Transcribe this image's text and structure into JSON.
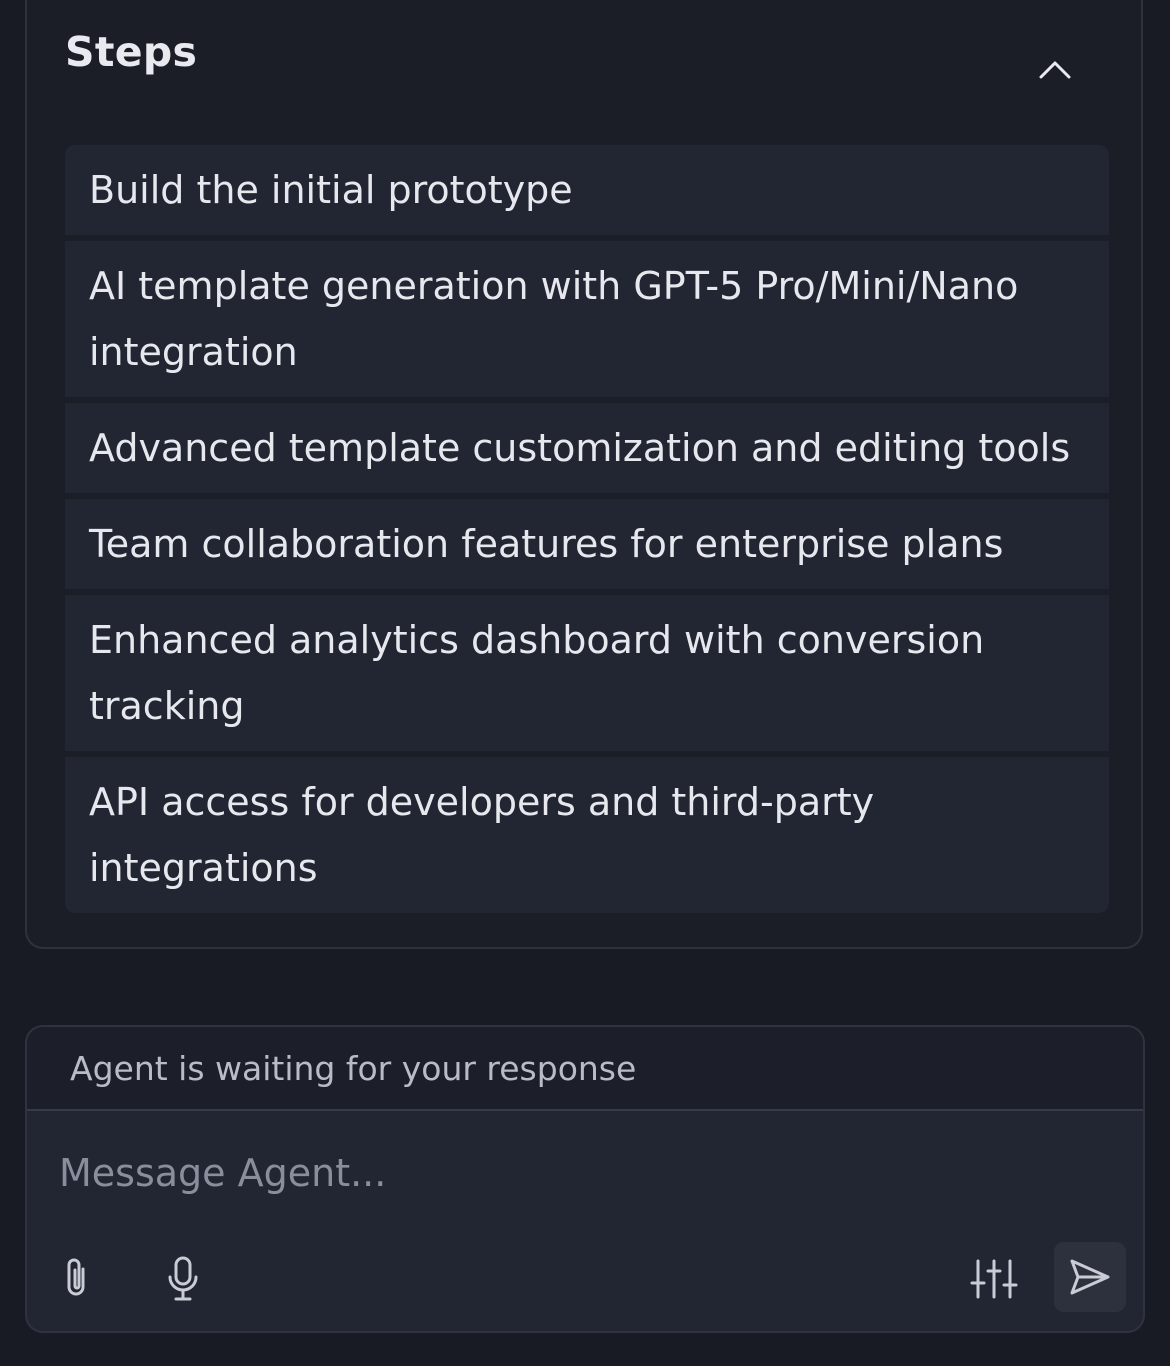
{
  "steps_panel": {
    "title": "Steps",
    "collapse_icon": "chevron-up-icon",
    "items": [
      {
        "label": "Build the initial prototype"
      },
      {
        "label": "AI template generation with GPT-5 Pro/Mini/Nano integration"
      },
      {
        "label": "Advanced template customization and editing tools"
      },
      {
        "label": "Team collaboration features for enterprise plans"
      },
      {
        "label": "Enhanced analytics dashboard with conversion tracking"
      },
      {
        "label": "API access for developers and third-party integrations"
      }
    ]
  },
  "composer": {
    "status_text": "Agent is waiting for your response",
    "placeholder": "Message Agent...",
    "value": "",
    "tools": {
      "attach_icon": "paperclip-icon",
      "mic_icon": "microphone-icon",
      "settings_icon": "sliders-icon",
      "send_icon": "send-icon"
    }
  },
  "colors": {
    "background": "#181b24",
    "card": "#1b1e27",
    "item": "#222532",
    "border": "#2e3240",
    "text": "#e6e8ee",
    "muted": "#8a8e9b"
  }
}
